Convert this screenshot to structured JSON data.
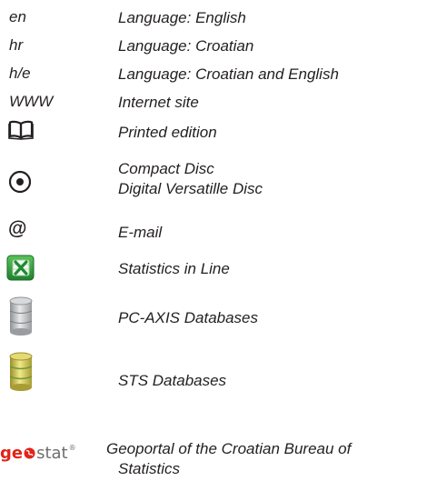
{
  "legend": {
    "items": [
      {
        "symbol": "en",
        "description": "Language: English"
      },
      {
        "symbol": "hr",
        "description": "Language: Croatian"
      },
      {
        "symbol": "h/e",
        "description": "Language: Croatian and English"
      },
      {
        "symbol": "WWW",
        "description": "Internet site"
      },
      {
        "icon": "open-book-icon",
        "description": "Printed edition"
      },
      {
        "icon": "compact-disc-icon",
        "description_lines": [
          "Compact Disc",
          "Digital Versatille Disc"
        ]
      },
      {
        "symbol": "@",
        "icon": "email-at-icon",
        "description": "E-mail"
      },
      {
        "icon": "excel-spreadsheet-icon",
        "description": "Statistics in Line"
      },
      {
        "icon": "grey-database-icon",
        "description": "PC-AXIS Databases"
      },
      {
        "icon": "yellow-database-icon",
        "description": "STS Databases"
      },
      {
        "icon": "geostat-logo",
        "logo_text": {
          "part1": "ge",
          "part2": "stat",
          "mark": "®"
        },
        "description_lines": [
          "Geoportal of the Croatian Bureau of",
          "Statistics"
        ]
      }
    ]
  },
  "colors": {
    "text": "#231f20",
    "geostat_red": "#e2231a",
    "geostat_grey": "#6f6f6f",
    "excel_green": "#2e9e3f",
    "db_grey": "#b7b9bb",
    "db_yellow": "#cfc35a"
  }
}
